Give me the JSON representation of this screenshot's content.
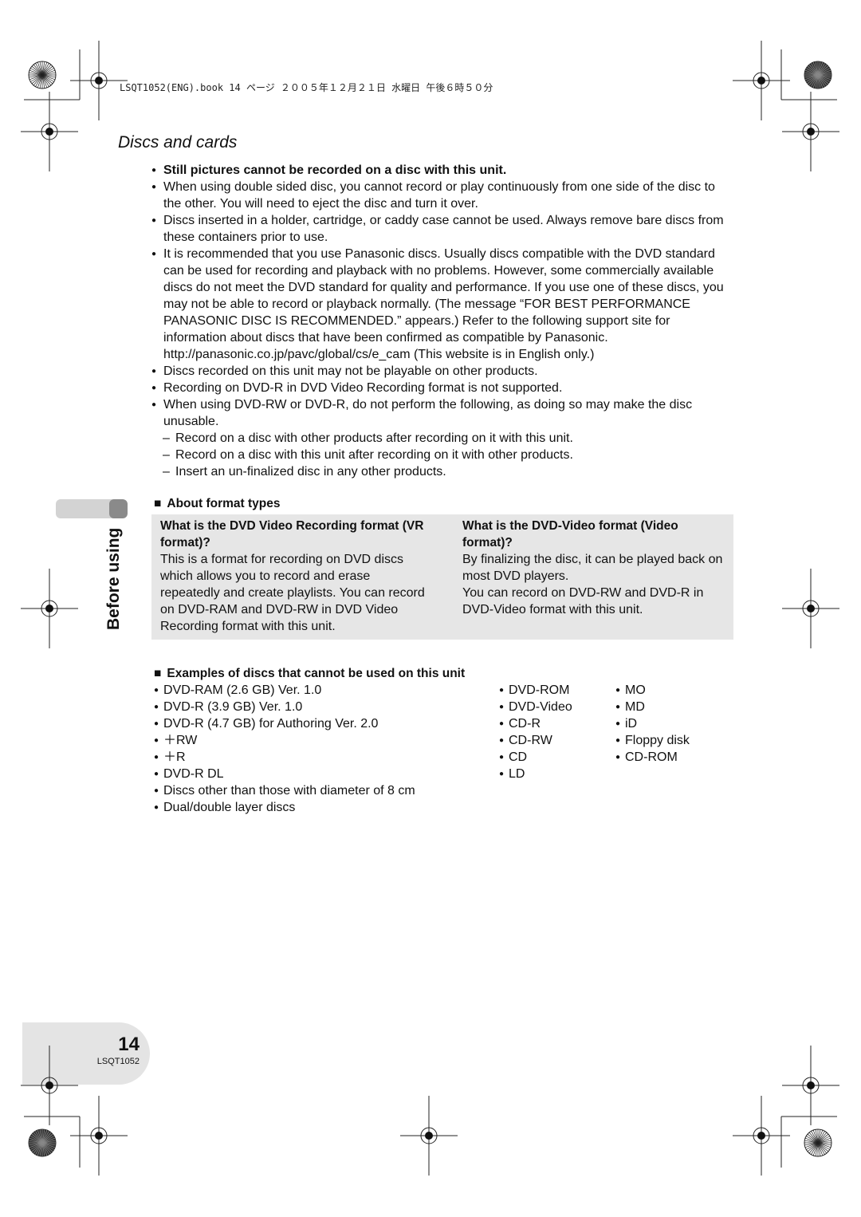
{
  "header": {
    "file_line": "LSQT1052(ENG).book  14 ページ  ２００５年１２月２１日  水曜日  午後６時５０分"
  },
  "title": "Discs and cards",
  "bullets": [
    "Still pictures cannot be recorded on a disc with this unit.",
    "When using double sided disc, you cannot record or play continuously from one side of the disc to the other. You will need to eject the disc and turn it over.",
    "Discs inserted in a holder, cartridge, or caddy case cannot be used. Always remove bare discs from these containers prior to use.",
    "It is recommended that you use Panasonic discs. Usually discs compatible with the DVD standard can be used for recording and playback with no problems. However, some commercially available discs do not meet the DVD standard for quality and performance. If you use one of these discs, you may not be able to record or playback normally. (The message “FOR BEST PERFORMANCE PANASONIC DISC IS RECOMMENDED.” appears.) Refer to the following support site for information about discs that have been confirmed as compatible by Panasonic. http://panasonic.co.jp/pavc/global/cs/e_cam (This website is in English only.)",
    "Discs recorded on this unit may not be playable on other products.",
    "Recording on DVD-R in DVD Video Recording format is not supported.",
    "When using DVD-RW or DVD-R, do not perform the following, as doing so may make the disc unusable."
  ],
  "sub_items": [
    "Record on a disc with other products after recording on it with this unit.",
    "Record on a disc with this unit after recording on it with other products.",
    "Insert an un-finalized disc in any other products."
  ],
  "format_section": {
    "heading": "About format types",
    "vr": {
      "title": "What is the DVD Video Recording format (VR format)?",
      "body": "This is a format for recording on DVD discs which allows you to record and erase repeatedly and create playlists. You can record on DVD-RAM and DVD-RW in DVD Video Recording format with this unit."
    },
    "video": {
      "title": "What is the DVD-Video format (Video format)?",
      "body1": "By finalizing the disc, it can be played back on most DVD players.",
      "body2": "You can record on DVD-RW and DVD-R in DVD-Video format with this unit."
    }
  },
  "examples": {
    "heading": "Examples of discs that cannot be used on this unit",
    "col1": [
      "DVD-RAM (2.6 GB) Ver. 1.0",
      "DVD-R (3.9 GB) Ver. 1.0",
      "DVD-R (4.7 GB) for Authoring Ver. 2.0",
      "＋RW",
      "＋R",
      "DVD-R DL",
      "Discs other than those with diameter of 8 cm",
      "Dual/double layer discs"
    ],
    "col2": [
      "DVD-ROM",
      "DVD-Video",
      "CD-R",
      "CD-RW",
      "CD",
      "LD"
    ],
    "col3": [
      "MO",
      "MD",
      "iD",
      "Floppy disk",
      "CD-ROM"
    ]
  },
  "side_tab": "Before using",
  "footer": {
    "page_number": "14",
    "code": "LSQT1052"
  }
}
